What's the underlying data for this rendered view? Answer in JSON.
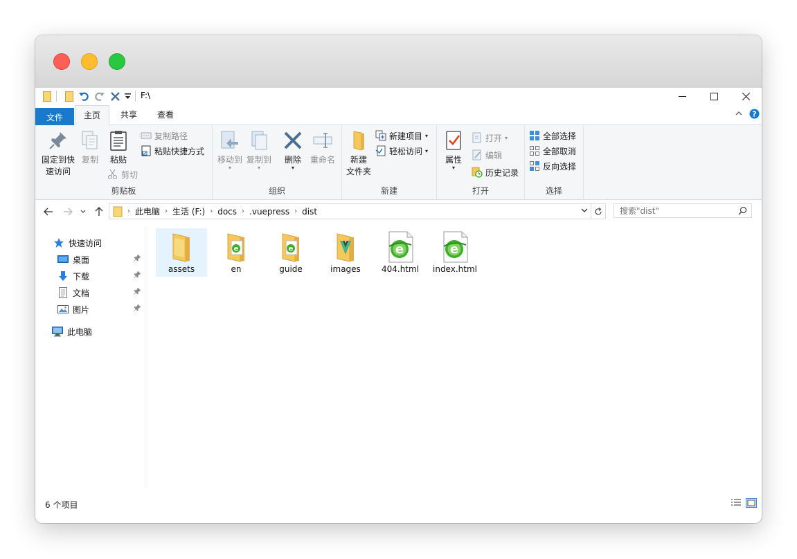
{
  "window": {
    "title": "F:\\",
    "controls": {
      "minimize": "—",
      "maximize": "☐",
      "close": "✕"
    }
  },
  "tabs": {
    "file": "文件",
    "home": "主页",
    "share": "共享",
    "view": "查看"
  },
  "ribbon": {
    "clipboard": {
      "label": "剪贴板",
      "pin_line1": "固定到快",
      "pin_line2": "速访问",
      "copy": "复制",
      "paste": "粘贴",
      "copy_path": "复制路径",
      "paste_shortcut": "粘贴快捷方式",
      "cut": "剪切"
    },
    "organize": {
      "label": "组织",
      "move_to": "移动到",
      "copy_to": "复制到",
      "delete": "删除",
      "rename": "重命名"
    },
    "new": {
      "label": "新建",
      "new_folder_line1": "新建",
      "new_folder_line2": "文件夹",
      "new_item": "新建项目",
      "easy_access": "轻松访问"
    },
    "open": {
      "label": "打开",
      "properties": "属性",
      "open": "打开",
      "edit": "编辑",
      "history": "历史记录"
    },
    "select": {
      "label": "选择",
      "select_all": "全部选择",
      "select_none": "全部取消",
      "invert": "反向选择"
    }
  },
  "address": {
    "crumbs": [
      "此电脑",
      "生活 (F:)",
      "docs",
      ".vuepress",
      "dist"
    ]
  },
  "search": {
    "placeholder": "搜索\"dist\""
  },
  "nav": {
    "quick_access": "快速访问",
    "items": [
      "桌面",
      "下载",
      "文档",
      "图片"
    ],
    "this_pc": "此电脑"
  },
  "files": [
    {
      "name": "assets",
      "kind": "folder",
      "selected": true
    },
    {
      "name": "en",
      "kind": "folder-ie"
    },
    {
      "name": "guide",
      "kind": "folder-ie"
    },
    {
      "name": "images",
      "kind": "folder-vue"
    },
    {
      "name": "404.html",
      "kind": "html"
    },
    {
      "name": "index.html",
      "kind": "html"
    }
  ],
  "status": {
    "count": "6 个项目"
  },
  "colors": {
    "accent": "#1979ca",
    "selection": "#e5f3ff",
    "folder": "#f4c85a",
    "ie_green": "#3fae2a"
  }
}
